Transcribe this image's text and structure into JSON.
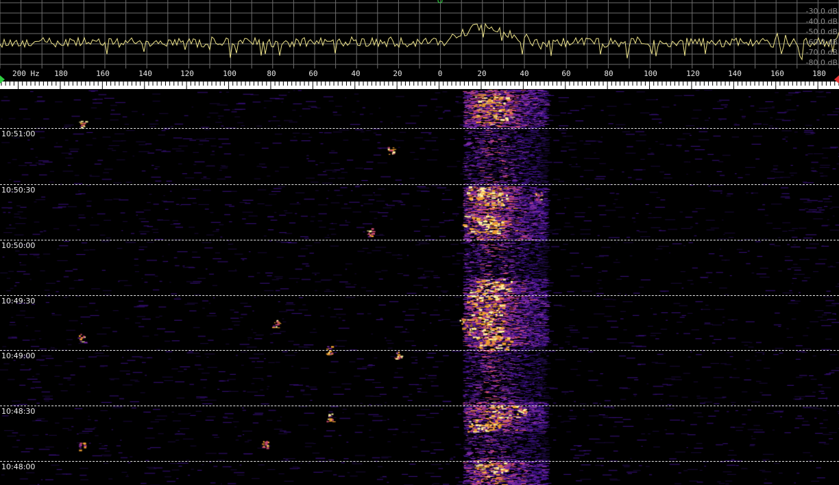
{
  "spectrum": {
    "db_labels": [
      "-30.0 dB",
      "-40.0 dB",
      "-50.0 dB",
      "-60.0 dB",
      "-70.0 dB",
      "-80.0 dB"
    ],
    "trace_color": "#f0e68c",
    "grid_color": "#6e6e6e",
    "center_marker_color": "#2ecc40"
  },
  "scale": {
    "unit_label": "200 Hz",
    "ticks": [
      "180",
      "160",
      "140",
      "120",
      "100",
      "80",
      "60",
      "40",
      "20",
      "0",
      "20",
      "40",
      "60",
      "80",
      "100",
      "120",
      "140",
      "160",
      "180"
    ],
    "left_handle_color": "#2ecc40",
    "right_handle_color": "#e03030"
  },
  "waterfall": {
    "time_labels": [
      "10:51:00",
      "10:50:30",
      "10:50:00",
      "10:49:30",
      "10:49:00",
      "10:48:30",
      "10:48:00"
    ],
    "palette": [
      "#000000",
      "#1a0a3a",
      "#3a1080",
      "#7a2aa0",
      "#c84a70",
      "#f0a030",
      "#fff4a0"
    ]
  }
}
